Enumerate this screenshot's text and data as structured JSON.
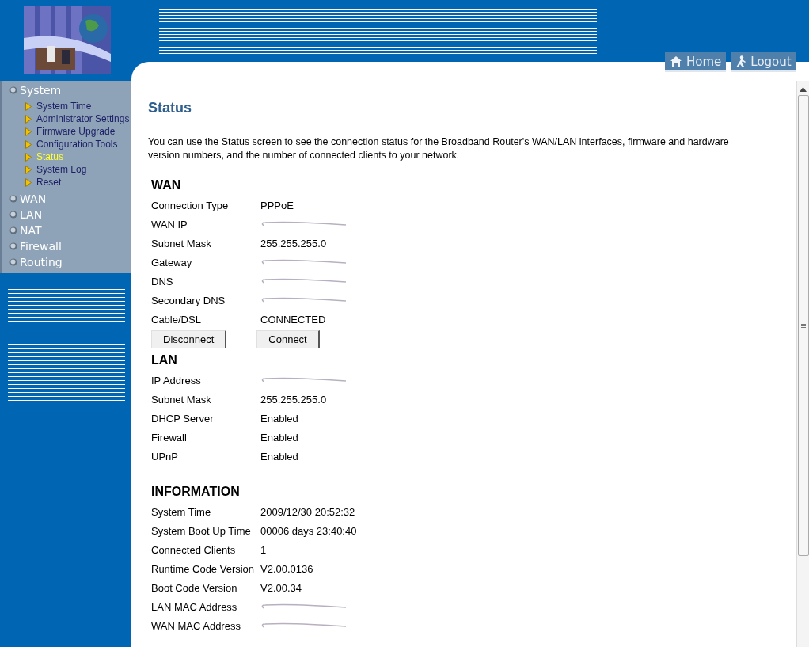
{
  "header": {
    "buttons": [
      {
        "kind": "home",
        "label": "Home"
      },
      {
        "kind": "logout",
        "label": "Logout"
      }
    ]
  },
  "sidebar": {
    "items": [
      {
        "label": "System",
        "children": [
          {
            "label": "System Time",
            "selected": false
          },
          {
            "label": "Administrator Settings",
            "selected": false
          },
          {
            "label": "Firmware Upgrade",
            "selected": false
          },
          {
            "label": "Configuration Tools",
            "selected": false
          },
          {
            "label": "Status",
            "selected": true
          },
          {
            "label": "System Log",
            "selected": false
          },
          {
            "label": "Reset",
            "selected": false
          }
        ]
      },
      {
        "label": "WAN"
      },
      {
        "label": "LAN"
      },
      {
        "label": "NAT"
      },
      {
        "label": "Firewall"
      },
      {
        "label": "Routing"
      }
    ]
  },
  "content": {
    "title": "Status",
    "description": "You can use the Status screen to see the connection status for the Broadband Router's WAN/LAN interfaces, firmware and hardware version numbers, and the number of connected clients to your network.",
    "sections": [
      {
        "heading": "WAN",
        "rows": [
          {
            "kind": "text",
            "label": "Connection Type",
            "value": "PPPoE"
          },
          {
            "kind": "redacted",
            "label": "WAN IP"
          },
          {
            "kind": "text",
            "label": "Subnet Mask",
            "value": "255.255.255.0"
          },
          {
            "kind": "redacted",
            "label": "Gateway"
          },
          {
            "kind": "redacted",
            "label": "DNS"
          },
          {
            "kind": "redacted",
            "label": "Secondary DNS"
          },
          {
            "kind": "text",
            "label": "Cable/DSL",
            "value": "CONNECTED"
          }
        ],
        "buttons": [
          "Disconnect",
          "Connect"
        ]
      },
      {
        "heading": "LAN",
        "rows": [
          {
            "kind": "redacted",
            "label": "IP Address"
          },
          {
            "kind": "text",
            "label": "Subnet Mask",
            "value": "255.255.255.0"
          },
          {
            "kind": "text",
            "label": "DHCP Server",
            "value": "Enabled"
          },
          {
            "kind": "text",
            "label": "Firewall",
            "value": "Enabled"
          },
          {
            "kind": "text",
            "label": "UPnP",
            "value": "Enabled"
          }
        ]
      },
      {
        "heading": "INFORMATION",
        "rows": [
          {
            "kind": "text",
            "label": "System Time",
            "value": "2009/12/30 20:52:32"
          },
          {
            "kind": "text",
            "label": "System Boot Up Time",
            "value": "00006 days 23:40:40"
          },
          {
            "kind": "text",
            "label": "Connected Clients",
            "value": "1"
          },
          {
            "kind": "text",
            "label": "Runtime Code Version",
            "value": "V2.00.0136"
          },
          {
            "kind": "text",
            "label": "Boot Code Version",
            "value": "V2.00.34"
          },
          {
            "kind": "redacted",
            "label": "LAN MAC Address"
          },
          {
            "kind": "redacted",
            "label": "WAN MAC Address"
          }
        ]
      }
    ]
  }
}
